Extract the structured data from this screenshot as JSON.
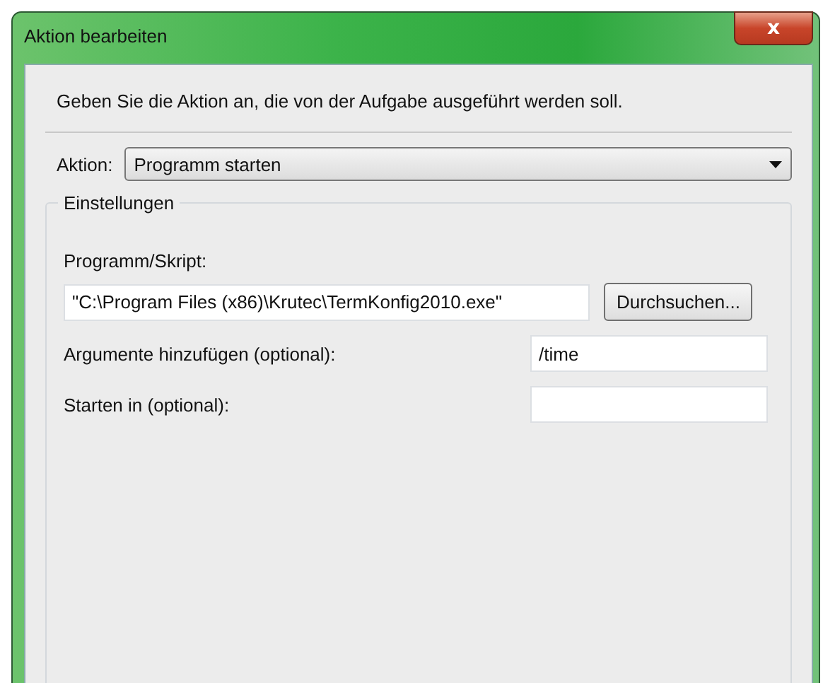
{
  "window": {
    "title": "Aktion bearbeiten",
    "close": "x"
  },
  "instruction": "Geben Sie die Aktion an, die von der Aufgabe ausgeführt werden soll.",
  "action": {
    "label": "Aktion:",
    "value": "Programm starten"
  },
  "settings": {
    "title": "Einstellungen",
    "program": {
      "label": "Programm/Skript:",
      "value": "\"C:\\Program Files (x86)\\Krutec\\TermKonfig2010.exe\"",
      "button": "Durchsuchen..."
    },
    "fields": [
      {
        "label": "Argumente hinzufügen (optional):",
        "value": "/time"
      },
      {
        "label": "Starten in (optional):"
      }
    ]
  }
}
